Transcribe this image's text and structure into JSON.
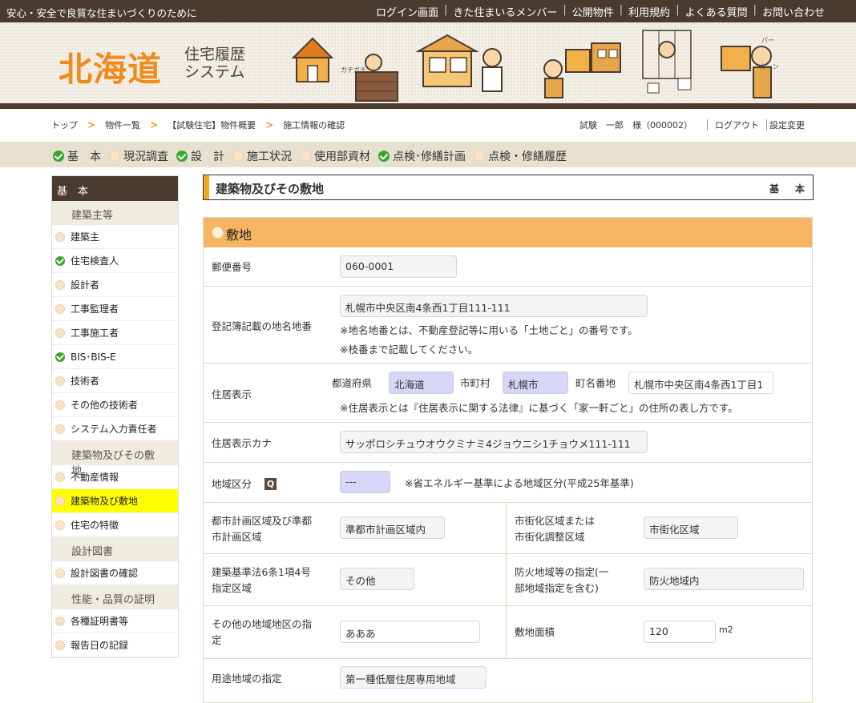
{
  "topbar": {
    "tagline": "安心・安全で良質な住まいづくりのために",
    "nav": [
      "ログイン画面",
      "きた住まいるメンバー",
      "公開物件",
      "利用規約",
      "よくある質問",
      "お問い合わせ"
    ]
  },
  "header": {
    "logo_main": "北海道",
    "logo_sub_1": "住宅履歴",
    "logo_sub_2": "システム",
    "cartoon_text_1": "ガチガチ",
    "cartoon_text_2": "パー",
    "cartoon_text_3": "カーン"
  },
  "breadcrumb": [
    "トップ",
    "物件一覧",
    "【試験住宅】物件概要",
    "施工情報の確認"
  ],
  "user": {
    "name": "試験　一郎　様（000002）",
    "logout": "ログアウト",
    "settings": "設定変更"
  },
  "tabs": [
    {
      "label": "基　本",
      "status": "done"
    },
    {
      "label": "現況調査",
      "status": "todo"
    },
    {
      "label": "設　計",
      "status": "done"
    },
    {
      "label": "施工状況",
      "status": "todo"
    },
    {
      "label": "使用部資材",
      "status": "todo"
    },
    {
      "label": "点検･修繕計画",
      "status": "done"
    },
    {
      "label": "点検・修繕履歴",
      "status": "todo"
    }
  ],
  "sidebar": {
    "header": "基　本",
    "groups": [
      {
        "title": "建築主等",
        "items": [
          {
            "label": "建築主",
            "status": "todo"
          },
          {
            "label": "住宅検査人",
            "status": "done"
          },
          {
            "label": "設計者",
            "status": "todo"
          },
          {
            "label": "工事監理者",
            "status": "todo"
          },
          {
            "label": "工事施工者",
            "status": "todo"
          },
          {
            "label": "BIS･BIS-E",
            "status": "done"
          },
          {
            "label": "技術者",
            "status": "todo"
          },
          {
            "label": "その他の技術者",
            "status": "todo"
          },
          {
            "label": "システム入力責任者",
            "status": "todo"
          }
        ]
      },
      {
        "title": "建築物及びその敷地",
        "items": [
          {
            "label": "不動産情報",
            "status": "todo"
          },
          {
            "label": "建築物及び敷地",
            "status": "todo",
            "active": true
          },
          {
            "label": "住宅の特徴",
            "status": "todo"
          }
        ]
      },
      {
        "title": "設計図書",
        "items": [
          {
            "label": "設計図書の確認",
            "status": "todo"
          }
        ]
      },
      {
        "title": "性能・品質の証明",
        "items": [
          {
            "label": "各種証明書等",
            "status": "todo"
          },
          {
            "label": "報告日の記録",
            "status": "todo"
          }
        ]
      }
    ]
  },
  "main": {
    "title": "建築物及びその敷地",
    "section_label": "基　本",
    "panel_title": "敷地",
    "postal": {
      "label": "郵便番号",
      "value": "060-0001"
    },
    "registry": {
      "label": "登記簿記載の地名地番",
      "value": "札幌市中央区南4条西1丁目111-111",
      "note1": "※地名地番とは、不動産登記等に用いる「土地ごと」の番号です。",
      "note2": "※枝番まで記載してください。"
    },
    "address": {
      "label": "住居表示",
      "pref_label": "都道府県",
      "pref_value": "北海道",
      "city_label": "市町村",
      "city_value": "札幌市",
      "town_label": "町名番地",
      "town_value": "札幌市中央区南4条西1丁目1",
      "note": "※住居表示とは『住居表示に関する法律』に基づく「家一軒ごと」の住所の表し方です。"
    },
    "kana": {
      "label": "住居表示カナ",
      "value": "サッポロシチュウオウクミナミ4ジョウニシ1チョウメ111-111"
    },
    "region": {
      "label": "地域区分",
      "badge": "Q",
      "value": "---",
      "note": "※省エネルギー基準による地域区分(平成25年基準)"
    },
    "city_planning": {
      "label_1": "都市計画区域及び準都",
      "label_2": "市計画区域",
      "value": "準都市計画区域内"
    },
    "urbanization": {
      "label_1": "市街化区域または",
      "label_2": "市街化調整区域",
      "value": "市街化区域"
    },
    "article6": {
      "label_1": "建築基準法6条1項4号",
      "label_2": "指定区域",
      "value": "その他"
    },
    "fire": {
      "label_1": "防火地域等の指定(一",
      "label_2": "部地域指定を含む)",
      "value": "防火地域内"
    },
    "other_district": {
      "label_1": "その他の地域地区の指",
      "label_2": "定",
      "value": "あああ"
    },
    "site_area": {
      "label": "敷地面積",
      "value": "120",
      "unit": "m2"
    },
    "use_district": {
      "label": "用途地域の指定",
      "value": "第一種低層住居専用地域"
    }
  }
}
